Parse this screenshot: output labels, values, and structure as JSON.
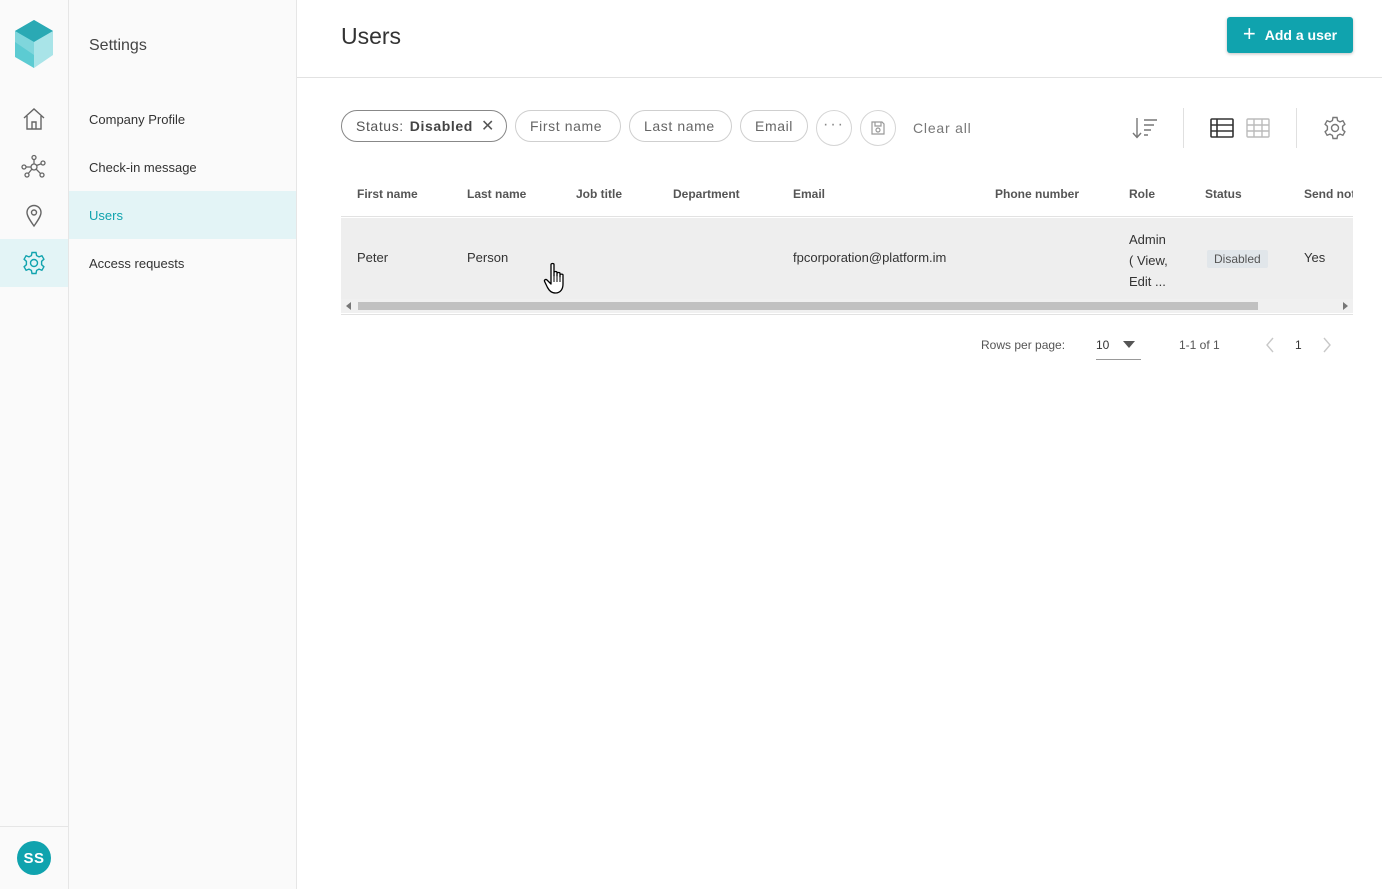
{
  "rail": {
    "avatar_initials": "SS",
    "items": [
      {
        "icon": "home-icon"
      },
      {
        "icon": "network-icon"
      },
      {
        "icon": "location-pin-icon"
      },
      {
        "icon": "gear-icon",
        "active": true
      }
    ]
  },
  "sidebar": {
    "title": "Settings",
    "items": [
      {
        "label": "Company Profile"
      },
      {
        "label": "Check-in message"
      },
      {
        "label": "Users",
        "active": true
      },
      {
        "label": "Access requests"
      }
    ]
  },
  "header": {
    "title": "Users",
    "add_button_label": "Add a user"
  },
  "filters": {
    "status_key": "Status:",
    "status_value": "Disabled",
    "chips": [
      "First name",
      "Last name",
      "Email"
    ],
    "clear_all": "Clear all"
  },
  "table": {
    "columns": [
      "First name",
      "Last name",
      "Job title",
      "Department",
      "Email",
      "Phone number",
      "Role",
      "Status",
      "Send not"
    ],
    "rows": [
      {
        "first_name": "Peter",
        "last_name": "Person",
        "job_title": "",
        "department": "",
        "email": "fpcorporation@platform.im",
        "phone": "",
        "role_lines": [
          "Admin",
          "( View,",
          "Edit ..."
        ],
        "status": "Disabled",
        "send_notification": "Yes"
      }
    ]
  },
  "pagination": {
    "rows_per_page_label": "Rows per page:",
    "rows_per_page_value": "10",
    "range": "1-1 of 1",
    "page": "1"
  },
  "colors": {
    "accent": "#10a3ae",
    "active_bg": "#e3f4f6",
    "row_hover": "#eeeeee"
  }
}
